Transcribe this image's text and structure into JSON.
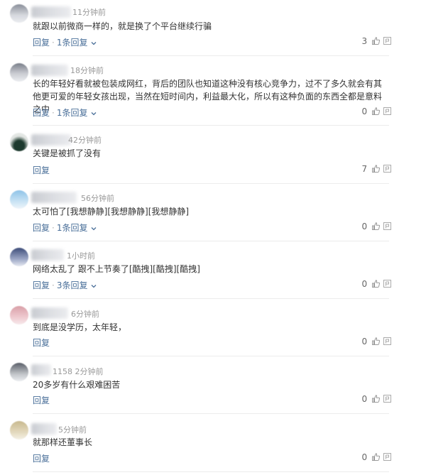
{
  "comments": [
    {
      "time": "11分钟前",
      "text": "就跟以前微商一样的，就是换了个平台继续行骗",
      "reply": "回复",
      "replies": "1条回复",
      "likes": "3"
    },
    {
      "time": "18分钟前",
      "text": "长的年轻好看就被包装成网红，背后的团队也知道这种没有核心竞争力，过不了多久就会有其他更可爱的年轻女孩出现，当然在短时间内，利益最大化，所以有这种负面的东西全都是意料之中",
      "reply": "回复",
      "replies": "1条回复",
      "likes": "0"
    },
    {
      "time": "42分钟前",
      "text": "关键是被抓了没有",
      "reply": "回复",
      "replies": "",
      "likes": "7"
    },
    {
      "time": "56分钟前",
      "text": "太可怕了[我想静静][我想静静][我想静静]",
      "reply": "回复",
      "replies": "1条回复",
      "likes": "0"
    },
    {
      "time": "1小时前",
      "text": "网络太乱了 跟不上节奏了[酷拽][酷拽][酷拽]",
      "reply": "回复",
      "replies": "3条回复",
      "likes": "0"
    },
    {
      "time": "6分钟前",
      "text": "到底是没学历，太年轻，",
      "reply": "回复",
      "replies": "",
      "likes": "0"
    },
    {
      "time": "1158 2分钟前",
      "text": "20多岁有什么艰难困苦",
      "reply": "回复",
      "replies": "",
      "likes": "0"
    },
    {
      "time": "5分钟前",
      "text": "就那样还董事长",
      "reply": "回复",
      "replies": "",
      "likes": "0"
    }
  ],
  "colors": {
    "link": "#4a6f99",
    "muted": "#999999",
    "text": "#333333"
  },
  "icons": {
    "thumb": "thumbs-up-icon",
    "report": "report-icon",
    "expand": "chevron-down-icon"
  }
}
